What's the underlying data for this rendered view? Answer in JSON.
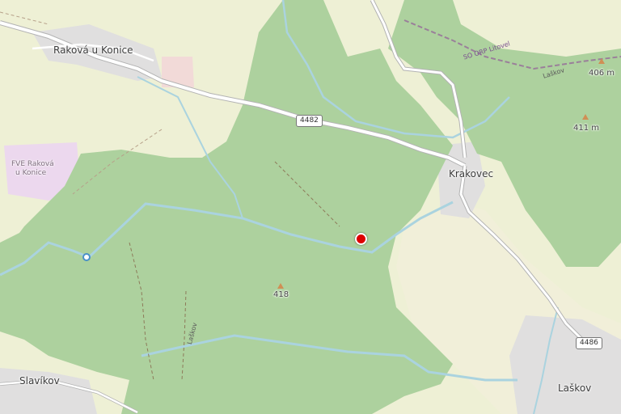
{
  "places": {
    "rakova": "Raková u Konice",
    "krakovec": "Krakovec",
    "slavikov": "Slavíkov",
    "laskov": "Laškov",
    "fve_line1": "FVE Raková",
    "fve_line2": "u Konice"
  },
  "roads": {
    "r4482": "4482",
    "r4486": "4486"
  },
  "peaks": {
    "p406": "406 m",
    "p411": "411 m",
    "p418": "418"
  },
  "streams": {
    "laskov_stream_1": "Laškov",
    "laskov_stream_2": "Laškov"
  },
  "boundary": {
    "orp_label": "SO ORP Litovel"
  },
  "colors": {
    "land": "#f2efe4",
    "farmland": "#eef0d5",
    "forest": "#add19e",
    "water": "#aad3df",
    "road": "#ffffff",
    "marker": "#dd0000"
  },
  "icons": {
    "location_marker": "red-dot-marker-icon",
    "peak": "triangle-peak-icon",
    "mill": "circle-water-icon"
  }
}
